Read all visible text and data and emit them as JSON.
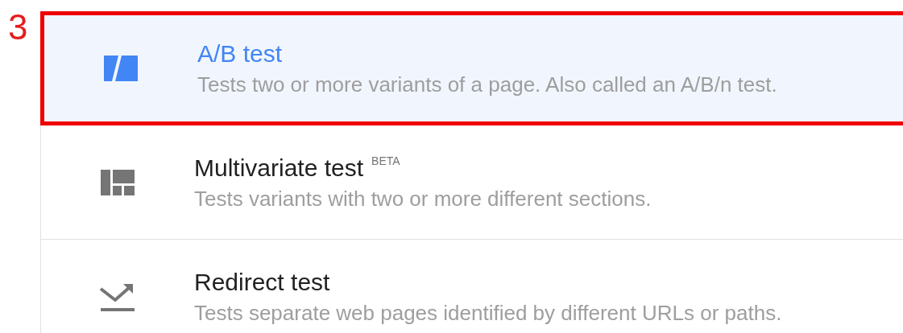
{
  "annotation": {
    "label": "3"
  },
  "experiment_types": [
    {
      "kind": "ab",
      "title": "A/B test",
      "description": "Tests two or more variants of a page. Also called an A/B/n test.",
      "selected": true,
      "highlighted": true
    },
    {
      "kind": "multivariate",
      "title": "Multivariate test",
      "badge": "BETA",
      "description": "Tests variants with two or more different sections.",
      "selected": false,
      "highlighted": false
    },
    {
      "kind": "redirect",
      "title": "Redirect test",
      "description": "Tests separate web pages identified by different URLs or paths.",
      "selected": false,
      "highlighted": false
    }
  ]
}
